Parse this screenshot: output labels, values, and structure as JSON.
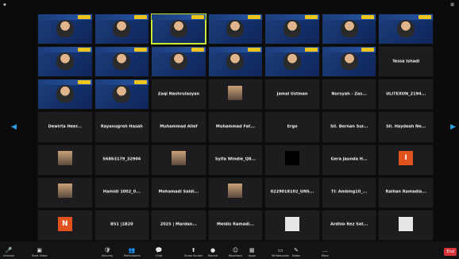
{
  "grid": {
    "tiles": [
      {
        "type": "video",
        "name": ""
      },
      {
        "type": "video",
        "name": ""
      },
      {
        "type": "video",
        "name": "",
        "active": true
      },
      {
        "type": "video",
        "name": ""
      },
      {
        "type": "video",
        "name": ""
      },
      {
        "type": "video",
        "name": ""
      },
      {
        "type": "video",
        "name": ""
      },
      {
        "type": "video",
        "name": ""
      },
      {
        "type": "video",
        "name": ""
      },
      {
        "type": "video",
        "name": ""
      },
      {
        "type": "video",
        "name": ""
      },
      {
        "type": "video",
        "name": ""
      },
      {
        "type": "video",
        "name": ""
      },
      {
        "type": "text",
        "center": "Tessa Ishadi",
        "name": ""
      },
      {
        "type": "video",
        "name": ""
      },
      {
        "type": "video",
        "name": ""
      },
      {
        "type": "text",
        "center": "Zaqi Nashrulasyan",
        "name": ""
      },
      {
        "type": "photo",
        "name": ""
      },
      {
        "type": "text",
        "center": "Jamal Ustman",
        "name": ""
      },
      {
        "type": "text",
        "center": "Nursyah - Zas...",
        "name": ""
      },
      {
        "type": "text",
        "center": "ULITEXON_2194...",
        "name": ""
      },
      {
        "type": "text",
        "center": "Dewirta Heer...",
        "name": ""
      },
      {
        "type": "text",
        "center": "Rayanugreh Hasah",
        "name": ""
      },
      {
        "type": "text",
        "center": "Muhammad Alief",
        "name": ""
      },
      {
        "type": "text",
        "center": "Muhammad Fat...",
        "name": ""
      },
      {
        "type": "text",
        "center": "Ergo",
        "name": ""
      },
      {
        "type": "text",
        "center": "Sll. Bernan Sur...",
        "name": ""
      },
      {
        "type": "text",
        "center": "Sll. Haydeah Ne...",
        "name": ""
      },
      {
        "type": "photo",
        "name": ""
      },
      {
        "type": "text",
        "center": "S6863179_32904",
        "name": ""
      },
      {
        "type": "photo",
        "name": ""
      },
      {
        "type": "text",
        "center": "Syifa Windie_Q8...",
        "name": ""
      },
      {
        "type": "dark",
        "name": ""
      },
      {
        "type": "text",
        "center": "Gera Jaunda H...",
        "name": ""
      },
      {
        "type": "orange",
        "letter": "I",
        "name": ""
      },
      {
        "type": "photo",
        "name": ""
      },
      {
        "type": "text",
        "center": "Hamidi 1002_0...",
        "name": ""
      },
      {
        "type": "text",
        "center": "Mohamadi Saldi...",
        "name": ""
      },
      {
        "type": "photo",
        "name": ""
      },
      {
        "type": "text",
        "center": "0229018102_UNS...",
        "name": ""
      },
      {
        "type": "text",
        "center": "TI: Ambing10_...",
        "name": ""
      },
      {
        "type": "text",
        "center": "Raihan Ramadia...",
        "name": ""
      },
      {
        "type": "orange",
        "letter": "N",
        "name": ""
      },
      {
        "type": "text",
        "center": "B51 |1B20",
        "name": ""
      },
      {
        "type": "text",
        "center": "2025 | Mardan...",
        "name": ""
      },
      {
        "type": "text",
        "center": "Meidis Ramadi...",
        "name": ""
      },
      {
        "type": "white",
        "name": ""
      },
      {
        "type": "text",
        "center": "Ardhio Rez Sat...",
        "name": ""
      },
      {
        "type": "white",
        "name": ""
      }
    ]
  },
  "toolbar": {
    "items": [
      {
        "label": "Unmute",
        "icon": "🎤"
      },
      {
        "label": "Start Video",
        "icon": "▣"
      },
      {
        "label": "Security",
        "icon": "🛡"
      },
      {
        "label": "Participants",
        "icon": "👥"
      },
      {
        "label": "Chat",
        "icon": "💬"
      },
      {
        "label": "Share Screen",
        "icon": "⬆"
      },
      {
        "label": "Record",
        "icon": "●"
      },
      {
        "label": "Reactions",
        "icon": "☺"
      },
      {
        "label": "Apps",
        "icon": "▦"
      },
      {
        "label": "Whiteboards",
        "icon": "▭"
      },
      {
        "label": "Notes",
        "icon": "✎"
      },
      {
        "label": "More",
        "icon": "…"
      }
    ],
    "end_label": "End"
  }
}
